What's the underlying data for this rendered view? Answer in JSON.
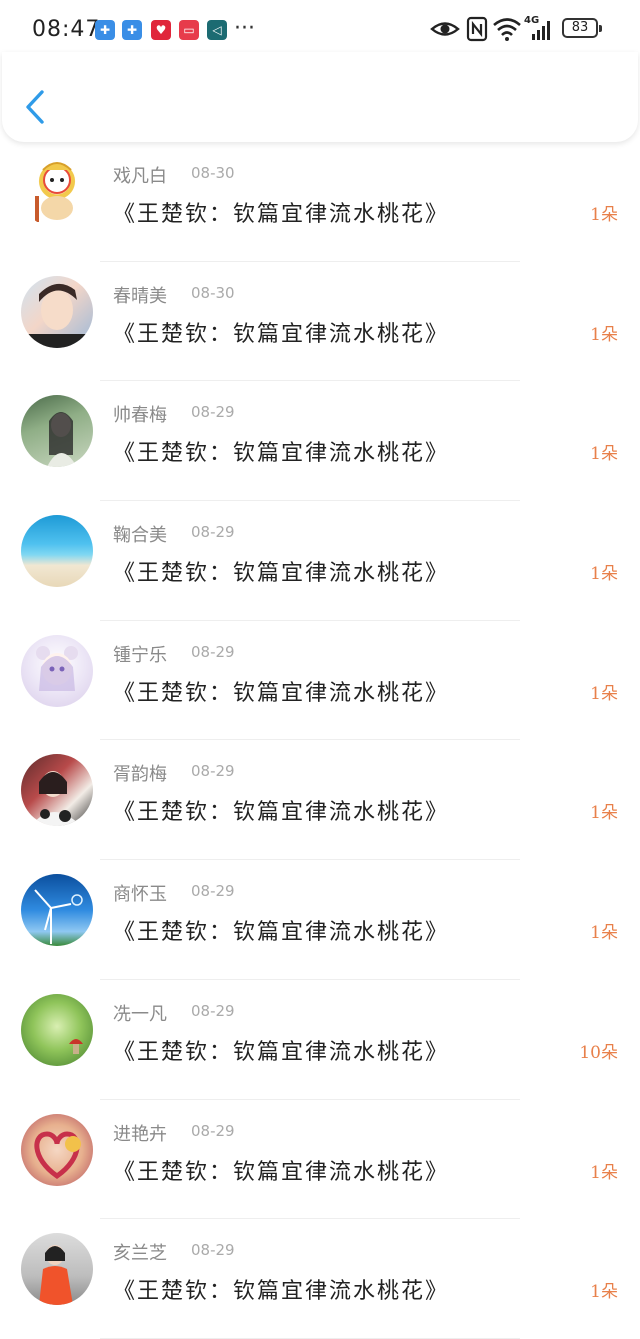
{
  "status_bar": {
    "time": "08:47",
    "more_icon_text": "···",
    "battery_level": "83",
    "network_label": "4G"
  },
  "header": {
    "back_icon": "chevron-left-icon"
  },
  "items": [
    {
      "name": "戏凡白",
      "date": "08-30",
      "title": "《王楚钦：钦篇宜律流水桃花》",
      "count": "1朵"
    },
    {
      "name": "春晴美",
      "date": "08-30",
      "title": "《王楚钦：钦篇宜律流水桃花》",
      "count": "1朵"
    },
    {
      "name": "帅春梅",
      "date": "08-29",
      "title": "《王楚钦：钦篇宜律流水桃花》",
      "count": "1朵"
    },
    {
      "name": "鞠合美",
      "date": "08-29",
      "title": "《王楚钦：钦篇宜律流水桃花》",
      "count": "1朵"
    },
    {
      "name": "锺宁乐",
      "date": "08-29",
      "title": "《王楚钦：钦篇宜律流水桃花》",
      "count": "1朵"
    },
    {
      "name": "胥韵梅",
      "date": "08-29",
      "title": "《王楚钦：钦篇宜律流水桃花》",
      "count": "1朵"
    },
    {
      "name": "商怀玉",
      "date": "08-29",
      "title": "《王楚钦：钦篇宜律流水桃花》",
      "count": "1朵"
    },
    {
      "name": "冼一凡",
      "date": "08-29",
      "title": "《王楚钦：钦篇宜律流水桃花》",
      "count": "10朵"
    },
    {
      "name": "进艳卉",
      "date": "08-29",
      "title": "《王楚钦：钦篇宜律流水桃花》",
      "count": "1朵"
    },
    {
      "name": "亥兰芝",
      "date": "08-29",
      "title": "《王楚钦：钦篇宜律流水桃花》",
      "count": "1朵"
    }
  ],
  "colors": {
    "accent_back": "#2f9be8",
    "count": "#e8804a"
  }
}
